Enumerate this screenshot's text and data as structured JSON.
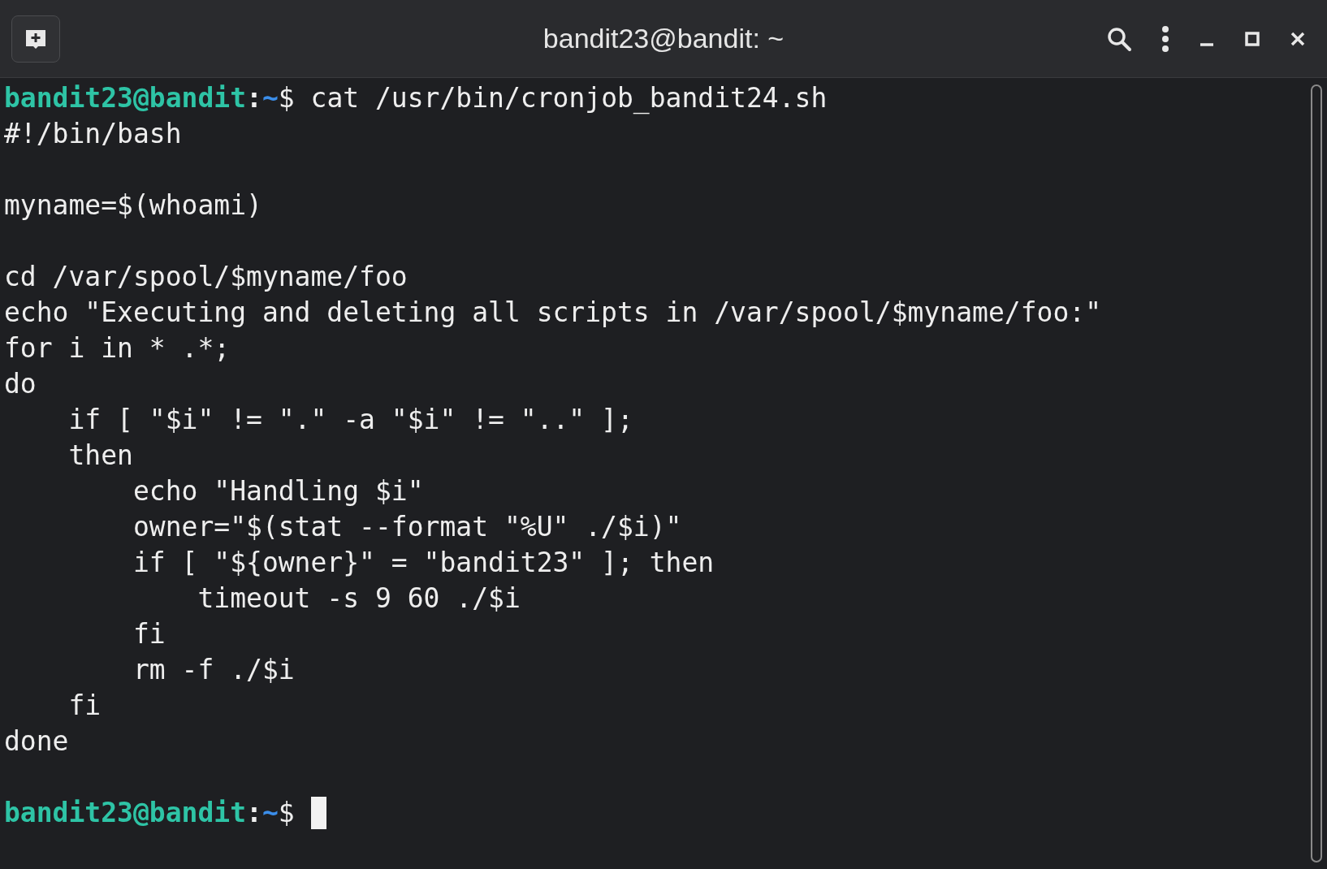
{
  "window": {
    "title": "bandit23@bandit: ~"
  },
  "lines": [
    {
      "kind": "prompt",
      "user_host": "bandit23@bandit",
      "separator": ":",
      "path": "~",
      "symbol": "$",
      "command": "cat /usr/bin/cronjob_bandit24.sh",
      "cursor": false
    },
    {
      "kind": "output",
      "text": "#!/bin/bash"
    },
    {
      "kind": "blank"
    },
    {
      "kind": "output",
      "text": "myname=$(whoami)"
    },
    {
      "kind": "blank"
    },
    {
      "kind": "output",
      "text": "cd /var/spool/$myname/foo"
    },
    {
      "kind": "output",
      "text": "echo \"Executing and deleting all scripts in /var/spool/$myname/foo:\""
    },
    {
      "kind": "output",
      "text": "for i in * .*;"
    },
    {
      "kind": "output",
      "text": "do"
    },
    {
      "kind": "output",
      "text": "    if [ \"$i\" != \".\" -a \"$i\" != \"..\" ];"
    },
    {
      "kind": "output",
      "text": "    then"
    },
    {
      "kind": "output",
      "text": "        echo \"Handling $i\""
    },
    {
      "kind": "output",
      "text": "        owner=\"$(stat --format \"%U\" ./$i)\""
    },
    {
      "kind": "output",
      "text": "        if [ \"${owner}\" = \"bandit23\" ]; then"
    },
    {
      "kind": "output",
      "text": "            timeout -s 9 60 ./$i"
    },
    {
      "kind": "output",
      "text": "        fi"
    },
    {
      "kind": "output",
      "text": "        rm -f ./$i"
    },
    {
      "kind": "output",
      "text": "    fi"
    },
    {
      "kind": "output",
      "text": "done"
    },
    {
      "kind": "blank"
    },
    {
      "kind": "prompt",
      "user_host": "bandit23@bandit",
      "separator": ":",
      "path": "~",
      "symbol": "$",
      "cursor": true
    }
  ]
}
